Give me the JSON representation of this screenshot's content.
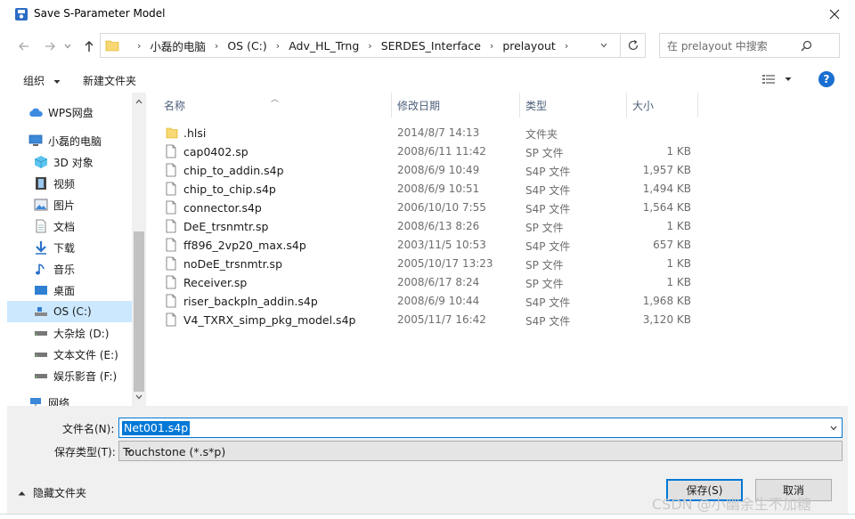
{
  "window": {
    "title": "Save S-Parameter Model",
    "icon": "save-dialog-icon",
    "close_icon": "close-icon"
  },
  "nav": {
    "back_icon": "arrow-left-icon",
    "forward_icon": "arrow-right-icon",
    "recent_icon": "chevron-down-icon",
    "up_icon": "arrow-up-icon",
    "breadcrumbs": [
      "小磊的电脑",
      "OS (C:)",
      "Adv_HL_Trng",
      "SERDES_Interface",
      "prelayout"
    ],
    "refresh_icon": "refresh-icon",
    "search_placeholder": "在 prelayout 中搜索",
    "search_icon": "search-icon"
  },
  "toolbar": {
    "organize_label": "组织",
    "new_folder_label": "新建文件夹",
    "view_icon": "view-options-icon",
    "help_label": "?"
  },
  "sidebar": {
    "items": [
      {
        "label": "WPS网盘",
        "icon": "cloud-icon"
      },
      {
        "label": "小磊的电脑",
        "icon": "computer-icon"
      },
      {
        "label": "3D 对象",
        "icon": "cube-icon"
      },
      {
        "label": "视频",
        "icon": "video-icon"
      },
      {
        "label": "图片",
        "icon": "picture-icon"
      },
      {
        "label": "文档",
        "icon": "document-icon"
      },
      {
        "label": "下载",
        "icon": "download-icon"
      },
      {
        "label": "音乐",
        "icon": "music-icon"
      },
      {
        "label": "桌面",
        "icon": "desktop-icon"
      },
      {
        "label": "OS (C:)",
        "icon": "drive-icon"
      },
      {
        "label": "大杂烩 (D:)",
        "icon": "drive-icon"
      },
      {
        "label": "文本文件 (E:)",
        "icon": "drive-icon"
      },
      {
        "label": "娱乐影音 (F:)",
        "icon": "drive-icon"
      },
      {
        "label": "网络",
        "icon": "network-icon"
      }
    ],
    "selected_index": 9
  },
  "filelist": {
    "columns": {
      "name": "名称",
      "date": "修改日期",
      "type": "类型",
      "size": "大小"
    },
    "files": [
      {
        "name": ".hlsi",
        "date": "2014/8/7 14:13",
        "type": "文件夹",
        "size": "",
        "kind": "folder"
      },
      {
        "name": "cap0402.sp",
        "date": "2008/6/11 11:42",
        "type": "SP 文件",
        "size": "1 KB",
        "kind": "file"
      },
      {
        "name": "chip_to_addin.s4p",
        "date": "2008/6/9 10:49",
        "type": "S4P 文件",
        "size": "1,957 KB",
        "kind": "file"
      },
      {
        "name": "chip_to_chip.s4p",
        "date": "2008/6/9 10:51",
        "type": "S4P 文件",
        "size": "1,494 KB",
        "kind": "file"
      },
      {
        "name": "connector.s4p",
        "date": "2006/10/10 7:55",
        "type": "S4P 文件",
        "size": "1,564 KB",
        "kind": "file"
      },
      {
        "name": "DeE_trsnmtr.sp",
        "date": "2008/6/13 8:26",
        "type": "SP 文件",
        "size": "1 KB",
        "kind": "file"
      },
      {
        "name": "ff896_2vp20_max.s4p",
        "date": "2003/11/5 10:53",
        "type": "S4P 文件",
        "size": "657 KB",
        "kind": "file"
      },
      {
        "name": "noDeE_trsnmtr.sp",
        "date": "2005/10/17 13:23",
        "type": "SP 文件",
        "size": "1 KB",
        "kind": "file"
      },
      {
        "name": "Receiver.sp",
        "date": "2008/6/17 8:24",
        "type": "SP 文件",
        "size": "1 KB",
        "kind": "file"
      },
      {
        "name": "riser_backpln_addin.s4p",
        "date": "2008/6/9 10:44",
        "type": "S4P 文件",
        "size": "1,968 KB",
        "kind": "file"
      },
      {
        "name": "V4_TXRX_simp_pkg_model.s4p",
        "date": "2005/11/7 16:42",
        "type": "S4P 文件",
        "size": "3,120 KB",
        "kind": "file"
      }
    ]
  },
  "form": {
    "filename_label": "文件名(N):",
    "filename_value": "Net001.s4p",
    "filetype_label": "保存类型(T):",
    "filetype_value": "Touchstone (*.s*p)"
  },
  "footer": {
    "hide_folders_label": "隐藏文件夹",
    "save_label": "保存(S)",
    "cancel_label": "取消",
    "watermark": "CSDN @小幽余生不加糖"
  },
  "colors": {
    "accent": "#0078d7",
    "selected_bg": "#cce8ff",
    "folder": "#f8d775",
    "bottom_bg": "#f0f0f0"
  }
}
